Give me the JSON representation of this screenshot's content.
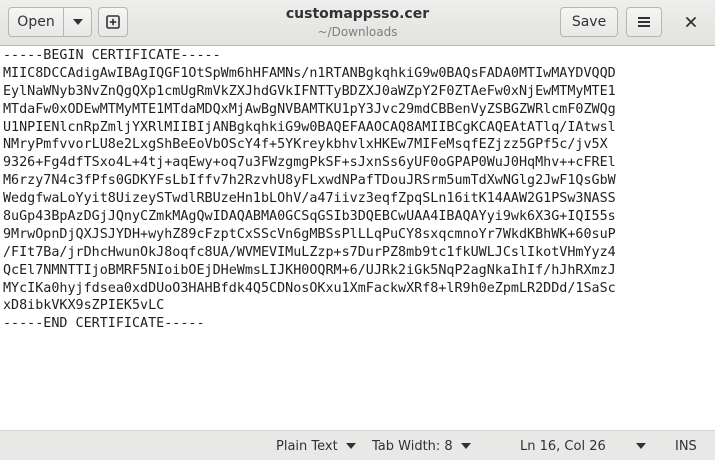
{
  "header": {
    "open_label": "Open",
    "title": "customappsso.cer",
    "subtitle": "~/Downloads",
    "save_label": "Save",
    "icons": {
      "open_menu": "chevron-down-icon",
      "new_tab": "new-document-icon",
      "menu": "hamburger-menu-icon",
      "close": "close-icon"
    }
  },
  "editor": {
    "lines": [
      "-----BEGIN CERTIFICATE-----",
      "MIIC8DCCAdigAwIBAgIQGF1OtSpWm6hHFAMNs/n1RTANBgkqhkiG9w0BAQsFADA0MTIwMAYDVQQD",
      "EylNaWNyb3NvZnQgQXp1cmUgRmVkZXJhdGVkIFNTTyBDZXJ0aWZpY2F0ZTAeFw0xNjEwMTMyMTE1",
      "MTdaFw0xODEwMTMyMTE1MTdaMDQxMjAwBgNVBAMTKU1pY3Jvc29mdCBBenVyZSBGZWRlcmF0ZWQg",
      "U1NPIENlcnRpZmljYXRlMIIBIjANBgkqhkiG9w0BAQEFAAOCAQ8AMIIBCgKCAQEAtATlq/IAtwsl",
      "NMryPmfvvorLU8e2LxgShBeEoVbOScY4f+5YKreykbhvlxHKEw7MIFeMsqfEZjzz5GPf5c/jv5X",
      "9326+Fg4dfTSxo4L+4tj+aqEwy+oq7u3FWzgmgPkSF+sJxnSs6yUF0oGPAP0WuJ0HqMhv++cFREl",
      "M6rzy7N4c3fPfs0GDKYFsLbIffv7h2RzvhU8yFLxwdNPafTDouJRSrm5umTdXwNGlg2JwF1QsGbW",
      "WedgfwaLoYyit8UizeySTwdlRBUzeHn1bLOhV/a47iivz3eqfZpqSLn16itK14AAW2G1PSw3NASS",
      "8uGp43BpAzDGjJQnyCZmkMAgQwIDAQABMA0GCSqGSIb3DQEBCwUAA4IBAQAYyi9wk6X3G+IQI55s",
      "9MrwOpnDjQXJSJYDH+wyhZ89cFzptCxSScVn6gMBSsPlLLqPuCY8sxqcmnoYr7WkdKBhWK+60suP",
      "/FIt7Ba/jrDhcHwunOkJ8oqfc8UA/WVMEVIMuLZzp+s7DurPZ8mb9tc1fkUWLJCslIkotVHmYyz4",
      "QcEl7NMNTTIjoBMRF5NIoibOEjDHeWmsLIJKH0OQRM+6/UJRk2iGk5NqP2agNkaIhIf/hJhRXmzJ",
      "MYcIKa0hyjfdsea0xdDUoO3HAHBfdk4Q5CDNosOKxu1XmFackwXRf8+lR9h0eZpmLR2DDd/1SaSc",
      "xD8ibkVKX9sZPIEK5vLC",
      "-----END CERTIFICATE-----"
    ]
  },
  "statusbar": {
    "language": "Plain Text",
    "tab_width": "Tab Width: 8",
    "position": "Ln 16, Col 26",
    "mode": "INS",
    "icons": {
      "dropdown": "chevron-down-icon"
    }
  }
}
